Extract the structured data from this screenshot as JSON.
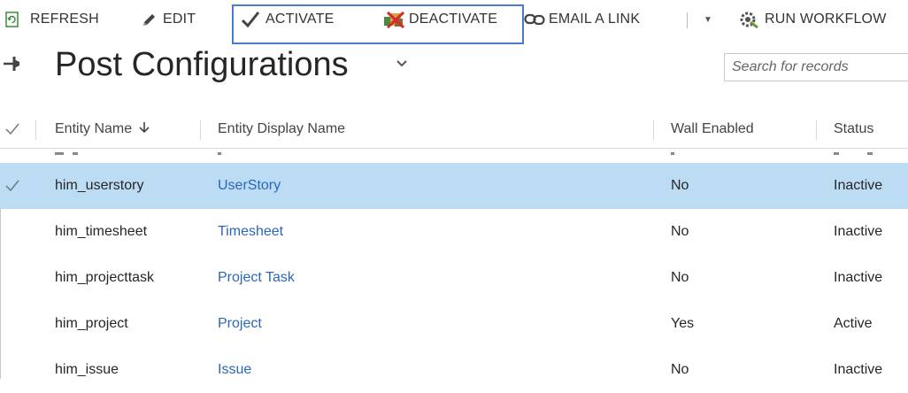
{
  "toolbar": {
    "refresh_label": "REFRESH",
    "edit_label": "EDIT",
    "activate_label": "ACTIVATE",
    "deactivate_label": "DEACTIVATE",
    "email_link_label": "EMAIL A LINK",
    "run_workflow_label": "RUN WORKFLOW"
  },
  "header": {
    "title": "Post Configurations",
    "search_placeholder": "Search for records"
  },
  "grid": {
    "columns": {
      "entity_name": "Entity Name",
      "entity_display_name": "Entity Display Name",
      "wall_enabled": "Wall Enabled",
      "status": "Status"
    },
    "rows": [
      {
        "entity_name": "him_userstory",
        "display_name": "UserStory",
        "wall_enabled": "No",
        "status": "Inactive"
      },
      {
        "entity_name": "him_timesheet",
        "display_name": "Timesheet",
        "wall_enabled": "No",
        "status": "Inactive"
      },
      {
        "entity_name": "him_projecttask",
        "display_name": "Project Task",
        "wall_enabled": "No",
        "status": "Inactive"
      },
      {
        "entity_name": "him_project",
        "display_name": "Project",
        "wall_enabled": "Yes",
        "status": "Active"
      },
      {
        "entity_name": "him_issue",
        "display_name": "Issue",
        "wall_enabled": "No",
        "status": "Inactive"
      }
    ]
  },
  "colors": {
    "selected_row": "#bcdcf4",
    "link": "#2a67b8",
    "highlight_border": "#4a7bd0"
  }
}
